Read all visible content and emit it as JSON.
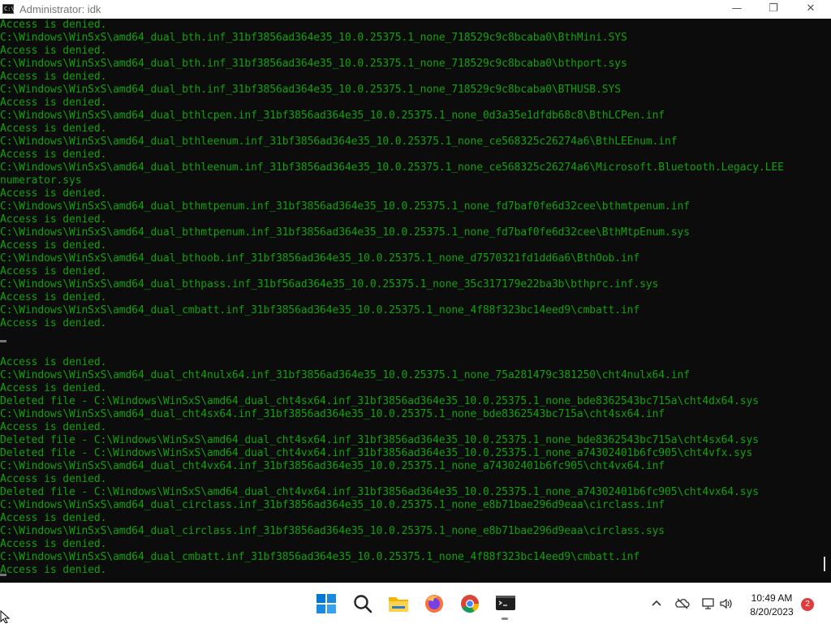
{
  "window": {
    "title": "Administrator: idk",
    "app_icon_text": "C:\\",
    "minimize_glyph": "—",
    "maximize_glyph": "❐",
    "close_glyph": "✕"
  },
  "console": {
    "lines": [
      "Access is denied.",
      "C:\\Windows\\WinSxS\\amd64_dual_bth.inf_31bf3856ad364e35_10.0.25375.1_none_718529c9c8bcaba0\\BthMini.SYS",
      "Access is denied.",
      "C:\\Windows\\WinSxS\\amd64_dual_bth.inf_31bf3856ad364e35_10.0.25375.1_none_718529c9c8bcaba0\\bthport.sys",
      "Access is denied.",
      "C:\\Windows\\WinSxS\\amd64_dual_bth.inf_31bf3856ad364e35_10.0.25375.1_none_718529c9c8bcaba0\\BTHUSB.SYS",
      "Access is denied.",
      "C:\\Windows\\WinSxS\\amd64_dual_bthlcpen.inf_31bf3856ad364e35_10.0.25375.1_none_0d3a35e1dfdb68c8\\BthLCPen.inf",
      "Access is denied.",
      "C:\\Windows\\WinSxS\\amd64_dual_bthleenum.inf_31bf3856ad364e35_10.0.25375.1_none_ce568325c26274a6\\BthLEEnum.inf",
      "Access is denied.",
      "C:\\Windows\\WinSxS\\amd64_dual_bthleenum.inf_31bf3856ad364e35_10.0.25375.1_none_ce568325c26274a6\\Microsoft.Bluetooth.Legacy.LEE",
      "numerator.sys",
      "Access is denied.",
      "C:\\Windows\\WinSxS\\amd64_dual_bthmtpenum.inf_31bf3856ad364e35_10.0.25375.1_none_fd7baf0fe6d32cee\\bthmtpenum.inf",
      "Access is denied.",
      "C:\\Windows\\WinSxS\\amd64_dual_bthmtpenum.inf_31bf3856ad364e35_10.0.25375.1_none_fd7baf0fe6d32cee\\BthMtpEnum.sys",
      "Access is denied.",
      "C:\\Windows\\WinSxS\\amd64_dual_bthoob.inf_31bf3856ad364e35_10.0.25375.1_none_d7570321fd1dd6a6\\BthOob.inf",
      "Access is denied.",
      "C:\\Windows\\WinSxS\\amd64_dual_bthpass.inf_31bf56ad364e35_10.0.25375.1_none_35c317179e22ba3b\\bthprc.inf.sys",
      "Access is denied.",
      "C:\\Windows\\WinSxS\\amd64_dual_cmbatt.inf_31bf3856ad364e35_10.0.25375.1_none_4f88f323bc14eed9\\cmbatt.inf",
      "Access is denied.",
      "",
      "",
      "Access is denied.",
      "C:\\Windows\\WinSxS\\amd64_dual_cht4nulx64.inf_31bf3856ad364e35_10.0.25375.1_none_75a281479c381250\\cht4nulx64.inf",
      "Access is denied.",
      "Deleted file - C:\\Windows\\WinSxS\\amd64_dual_cht4sx64.inf_31bf3856ad364e35_10.0.25375.1_none_bde8362543bc715a\\cht4dx64.sys",
      "C:\\Windows\\WinSxS\\amd64_dual_cht4sx64.inf_31bf3856ad364e35_10.0.25375.1_none_bde8362543bc715a\\cht4sx64.inf",
      "Access is denied.",
      "Deleted file - C:\\Windows\\WinSxS\\amd64_dual_cht4sx64.inf_31bf3856ad364e35_10.0.25375.1_none_bde8362543bc715a\\cht4sx64.sys",
      "Deleted file - C:\\Windows\\WinSxS\\amd64_dual_cht4vx64.inf_31bf3856ad364e35_10.0.25375.1_none_a74302401b6fc905\\cht4vfx.sys",
      "C:\\Windows\\WinSxS\\amd64_dual_cht4vx64.inf_31bf3856ad364e35_10.0.25375.1_none_a74302401b6fc905\\cht4vx64.inf",
      "Access is denied.",
      "Deleted file - C:\\Windows\\WinSxS\\amd64_dual_cht4vx64.inf_31bf3856ad364e35_10.0.25375.1_none_a74302401b6fc905\\cht4vx64.sys",
      "C:\\Windows\\WinSxS\\amd64_dual_circlass.inf_31bf3856ad364e35_10.0.25375.1_none_e8b71bae296d9eaa\\circlass.inf",
      "Access is denied.",
      "C:\\Windows\\WinSxS\\amd64_dual_circlass.inf_31bf3856ad364e35_10.0.25375.1_none_e8b71bae296d9eaa\\circlass.sys",
      "Access is denied.",
      "C:\\Windows\\WinSxS\\amd64_dual_cmbatt.inf_31bf3856ad364e35_10.0.25375.1_none_4f88f323bc14eed9\\cmbatt.inf",
      "Access is denied."
    ]
  },
  "taskbar": {
    "pinned": [
      "start-icon",
      "search-icon",
      "file-explorer-icon",
      "firefox-icon",
      "chrome-icon",
      "terminal-icon"
    ],
    "time": "10:49 AM",
    "date": "8/20/2023",
    "notification_count": "2",
    "colors": {
      "console_text": "#13a10e",
      "console_bg": "#0c0c0c",
      "accent": "#0078d4",
      "badge": "#e03c3c"
    }
  }
}
